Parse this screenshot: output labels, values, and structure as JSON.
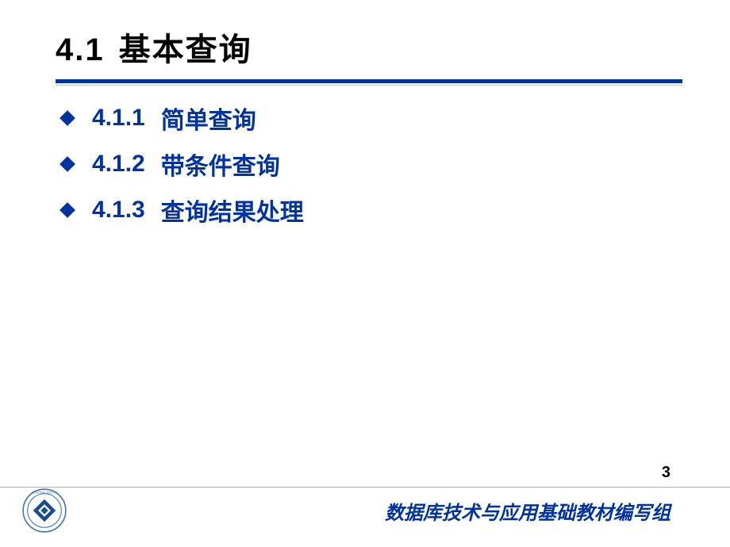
{
  "slide": {
    "title_number": "4.1",
    "title_text": "基本查询",
    "items": [
      {
        "number": "4.1.1",
        "text": "简单查询"
      },
      {
        "number": "4.1.2",
        "text": "带条件查询"
      },
      {
        "number": "4.1.3",
        "text": "查询结果处理"
      }
    ],
    "page_number": "3",
    "footer": "数据库技术与应用基础教材编写组"
  }
}
